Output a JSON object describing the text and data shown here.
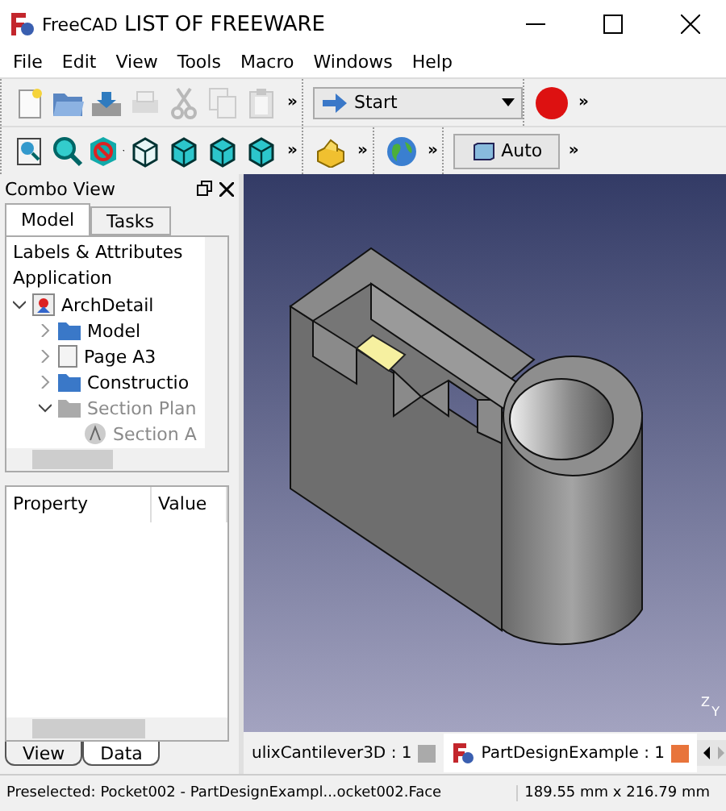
{
  "window": {
    "app": "FreeCAD",
    "title": "LIST OF FREEWARE"
  },
  "menu": [
    "File",
    "Edit",
    "View",
    "Tools",
    "Macro",
    "Windows",
    "Help"
  ],
  "toolbar_1": {
    "groups": [
      {
        "icons": [
          {
            "kind": "new",
            "disabled": false
          },
          {
            "kind": "open",
            "disabled": false
          },
          {
            "kind": "save",
            "disabled": false
          },
          {
            "kind": "print",
            "disabled": true
          },
          {
            "kind": "cut",
            "disabled": true
          },
          {
            "kind": "copy",
            "disabled": true
          },
          {
            "kind": "paste",
            "disabled": true
          }
        ],
        "more": "»"
      },
      {
        "workbench": "Start"
      },
      {
        "icons": [
          {
            "kind": "record",
            "disabled": false
          }
        ],
        "more": "»"
      }
    ]
  },
  "toolbar_2": {
    "groups": [
      {
        "icons": [
          {
            "kind": "fit",
            "disabled": false
          },
          {
            "kind": "zoom",
            "disabled": false
          },
          {
            "kind": "style",
            "disabled": false
          },
          {
            "kind": "iso",
            "disabled": false
          },
          {
            "kind": "front",
            "disabled": false
          },
          {
            "kind": "top",
            "disabled": false
          },
          {
            "kind": "right",
            "disabled": false
          }
        ],
        "more": "»"
      },
      {
        "icons": [
          {
            "kind": "part",
            "disabled": false
          }
        ],
        "more": "»"
      },
      {
        "icons": [
          {
            "kind": "globe",
            "disabled": false
          }
        ],
        "more": "»"
      },
      {
        "button": "Auto",
        "more": "»"
      }
    ]
  },
  "combo_view": {
    "title": "Combo View",
    "tabs": [
      {
        "label": "Model",
        "selected": true
      },
      {
        "label": "Tasks",
        "selected": false
      }
    ],
    "tree_header": "Labels & Attributes",
    "root": "Application",
    "tree": [
      {
        "label": "ArchDetail",
        "kind": "doc",
        "expanded": true,
        "visible": true,
        "children": [
          {
            "label": "Model",
            "kind": "folder",
            "expanded": false,
            "visible": true
          },
          {
            "label": "Page A3",
            "kind": "page",
            "expanded": false,
            "visible": true
          },
          {
            "label": "Constructio",
            "kind": "folder",
            "expanded": false,
            "visible": true
          },
          {
            "label": "Section Plan",
            "kind": "folder",
            "expanded": true,
            "visible": false,
            "children": [
              {
                "label": "Section A",
                "kind": "section",
                "visible": false
              }
            ]
          }
        ]
      }
    ],
    "property_columns": [
      "Property",
      "Value"
    ],
    "bottom_tabs": [
      {
        "label": "View",
        "selected": false
      },
      {
        "label": "Data",
        "selected": true
      }
    ]
  },
  "viewport": {
    "axis_labels": [
      "Z",
      "Y"
    ]
  },
  "document_tabs": [
    {
      "label": "ulixCantilever3D : 1",
      "selected": false
    },
    {
      "label": "PartDesignExample : 1",
      "selected": true
    }
  ],
  "status_bar": {
    "message": "Preselected: Pocket002 - PartDesignExampl...ocket002.Face",
    "dimensions": "189.55 mm x 216.79 mm"
  }
}
